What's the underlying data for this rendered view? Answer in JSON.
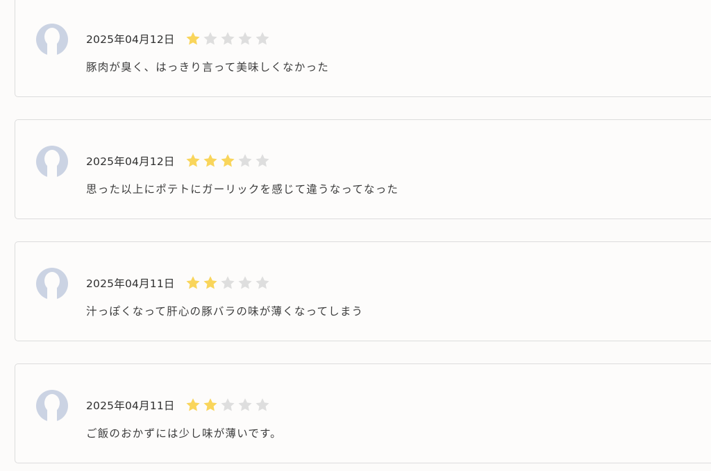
{
  "colors": {
    "star_filled": "#f9d55b",
    "star_empty": "#dedede",
    "avatar": "#cbd3e3",
    "card_border": "#dcdcdc"
  },
  "reviews": [
    {
      "date": "2025年04月12日",
      "rating": 1,
      "max_rating": 5,
      "comment": "豚肉が臭く、はっきり言って美味しくなかった"
    },
    {
      "date": "2025年04月12日",
      "rating": 3,
      "max_rating": 5,
      "comment": "思った以上にポテトにガーリックを感じて違うなってなった"
    },
    {
      "date": "2025年04月11日",
      "rating": 2,
      "max_rating": 5,
      "comment": "汁っぽくなって肝心の豚バラの味が薄くなってしまう"
    },
    {
      "date": "2025年04月11日",
      "rating": 2,
      "max_rating": 5,
      "comment": "ご飯のおかずには少し味が薄いです。"
    }
  ]
}
